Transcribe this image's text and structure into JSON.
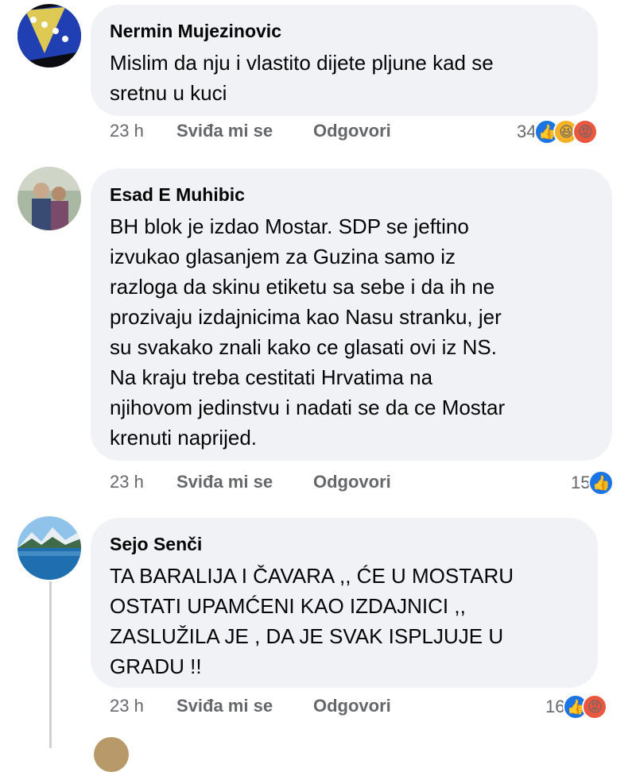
{
  "comments": [
    {
      "author": "Nermin Mujezinovic",
      "text": "Mislim da nju i vlastito dijete pljune kad se\nsretnu u kuci",
      "time": "23 h",
      "like_label": "Sviđa mi se",
      "reply_label": "Odgovori",
      "reaction_count": "34",
      "reactions": [
        "like",
        "haha",
        "angry"
      ]
    },
    {
      "author": "Esad E Muhibic",
      "text": "BH blok je izdao Mostar. SDP se jeftino\nizvukao glasanjem za Guzina samo iz\nrazloga da skinu etiketu sa sebe i da ih ne\nprozivaju izdajnicima kao Nasu stranku, jer\nsu svakako znali kako ce glasati ovi iz NS.\nNa kraju treba cestitati Hrvatima na\nnjihovom jedinstvu i nadati se da ce Mostar\nkrenuti naprijed.",
      "time": "23 h",
      "like_label": "Sviđa mi se",
      "reply_label": "Odgovori",
      "reaction_count": "15",
      "reactions": [
        "like"
      ]
    },
    {
      "author": "Sejo Senči",
      "text": "TA BARALIJA I ČAVARA ,, ĆE U MOSTARU\nOSTATI UPAMĆENI KAO IZDAJNICI ,,\nZASLUŽILA JE , DA JE SVAK ISPLJUJE U\nGRADU !!",
      "time": "23 h",
      "like_label": "Sviđa mi se",
      "reply_label": "Odgovori",
      "reaction_count": "16",
      "reactions": [
        "like",
        "angry"
      ]
    }
  ],
  "colors": {
    "bubble": "#f0f2f5",
    "meta": "#65676b",
    "like": "#1b74e4",
    "haha": "#f7b125",
    "angry": "#e9573f"
  }
}
